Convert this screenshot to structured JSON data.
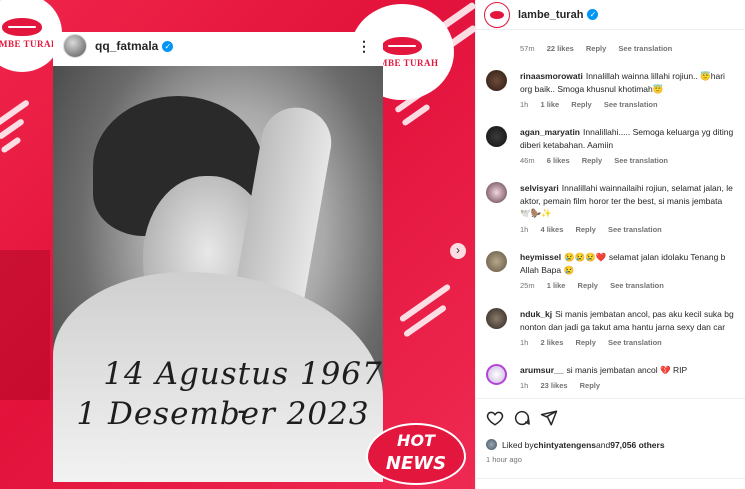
{
  "post": {
    "reposted_user": "qq_fatmala",
    "photo_caption_line1": "14 Agustus 1967 -",
    "photo_caption_line2": "1 Desember 2023",
    "badge_line1": "HOT",
    "badge_line2": "NEWS",
    "logo_text": "LAMBE TURAH",
    "brand_color": "#e3163d"
  },
  "panel": {
    "username": "lambe_turah"
  },
  "comments": [
    {
      "user": "",
      "text": "",
      "time": "57m",
      "likes": "22 likes",
      "reply": "Reply",
      "translate": "See translation"
    },
    {
      "user": "rinaasmorowati",
      "text": "Innalillah wainna lillahi rojiun.. 😇hari",
      "text2": "org baik.. Smoga khusnul khotimah😇",
      "time": "1h",
      "likes": "1 like",
      "reply": "Reply",
      "translate": "See translation"
    },
    {
      "user": "agan_maryatin",
      "text": "Innalillahi..... Semoga keluarga yg diting",
      "text2": "diberi ketabahan. Aamiin",
      "time": "46m",
      "likes": "6 likes",
      "reply": "Reply",
      "translate": "See translation"
    },
    {
      "user": "selvisyari",
      "text": "Innalillahi wainnailaihi rojiun, selamat jalan, le",
      "text2": "aktor, pemain film horor ter the best, si manis jembata",
      "text3": "🕊️🦫✨",
      "time": "1h",
      "likes": "4 likes",
      "reply": "Reply",
      "translate": "See translation"
    },
    {
      "user": "heymissel",
      "text": "😢😢😢❤️ selamat jalan idolaku Tenang b",
      "text2": "Allah Bapa 😢",
      "time": "25m",
      "likes": "1 like",
      "reply": "Reply",
      "translate": "See translation"
    },
    {
      "user": "nduk_kj",
      "text": "Si manis jembatan ancol, pas aku kecil suka bg",
      "text2": "nonton dan jadi ga takut ama hantu jarna sexy dan car",
      "time": "1h",
      "likes": "2 likes",
      "reply": "Reply",
      "translate": "See translation"
    },
    {
      "user": "arumsur__",
      "text": "si manis jembatan ancol 💔 RIP",
      "time": "1h",
      "likes": "23 likes",
      "reply": "Reply"
    }
  ],
  "footer": {
    "liked_by_prefix": "Liked by ",
    "liked_by_user": "chintyatengens",
    "liked_by_mid": " and ",
    "liked_by_count": "97,056 others",
    "time_ago": "1 hour ago"
  }
}
